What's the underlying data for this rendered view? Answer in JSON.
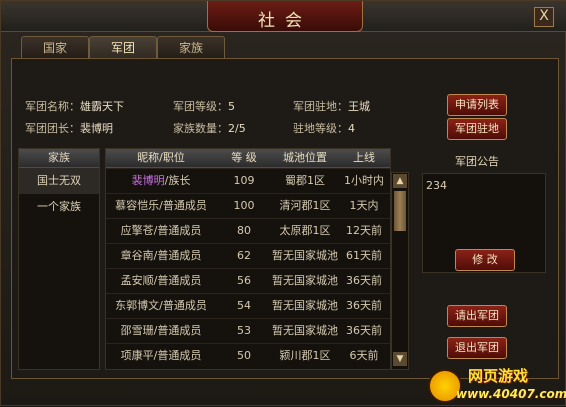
{
  "window": {
    "title": "社会",
    "close_label": "X"
  },
  "tabs": [
    {
      "label": "国家",
      "active": false
    },
    {
      "label": "军团",
      "active": true
    },
    {
      "label": "家族",
      "active": false
    }
  ],
  "info": {
    "name_label": "军团名称：",
    "name_value": "雄霸天下",
    "level_label": "军团等级：",
    "level_value": "5",
    "base_label": "军团驻地：",
    "base_value": "王城",
    "leader_label": "军团团长：",
    "leader_value": "裴博明",
    "family_count_label": "家族数量：",
    "family_count_value": "2/5",
    "base_level_label": "驻地等级：",
    "base_level_value": "4"
  },
  "buttons": {
    "apply_list": "申请列表",
    "legion_base": "军团驻地",
    "modify": "修 改",
    "kick": "请出军团",
    "quit": "退出军团"
  },
  "family_list": {
    "header": "家族",
    "items": [
      "国士无双",
      "一个家族"
    ]
  },
  "member_table": {
    "headers": [
      "昵称/职位",
      "等 级",
      "城池位置",
      "上线"
    ],
    "rows": [
      {
        "name": "裴博明",
        "role": "/族长",
        "level": "109",
        "city": "蜀郡1区",
        "online": "1小时内",
        "highlight": true
      },
      {
        "name": "慕容恺乐",
        "role": "/普通成员",
        "level": "100",
        "city": "清河郡1区",
        "online": "1天内",
        "highlight": false
      },
      {
        "name": "应擎苍",
        "role": "/普通成员",
        "level": "80",
        "city": "太原郡1区",
        "online": "12天前",
        "highlight": false
      },
      {
        "name": "章谷南",
        "role": "/普通成员",
        "level": "62",
        "city": "暂无国家城池",
        "online": "61天前",
        "highlight": false
      },
      {
        "name": "孟安顺",
        "role": "/普通成员",
        "level": "56",
        "city": "暂无国家城池",
        "online": "36天前",
        "highlight": false
      },
      {
        "name": "东郭博文",
        "role": "/普通成员",
        "level": "54",
        "city": "暂无国家城池",
        "online": "36天前",
        "highlight": false
      },
      {
        "name": "邵雪珊",
        "role": "/普通成员",
        "level": "53",
        "city": "暂无国家城池",
        "online": "36天前",
        "highlight": false
      },
      {
        "name": "项康平",
        "role": "/普通成员",
        "level": "50",
        "city": "颍川郡1区",
        "online": "6天前",
        "highlight": false
      }
    ]
  },
  "announcement": {
    "title": "军团公告",
    "text": "234"
  },
  "watermark": {
    "line1": "网页游戏",
    "line2": "www.40407.com"
  }
}
